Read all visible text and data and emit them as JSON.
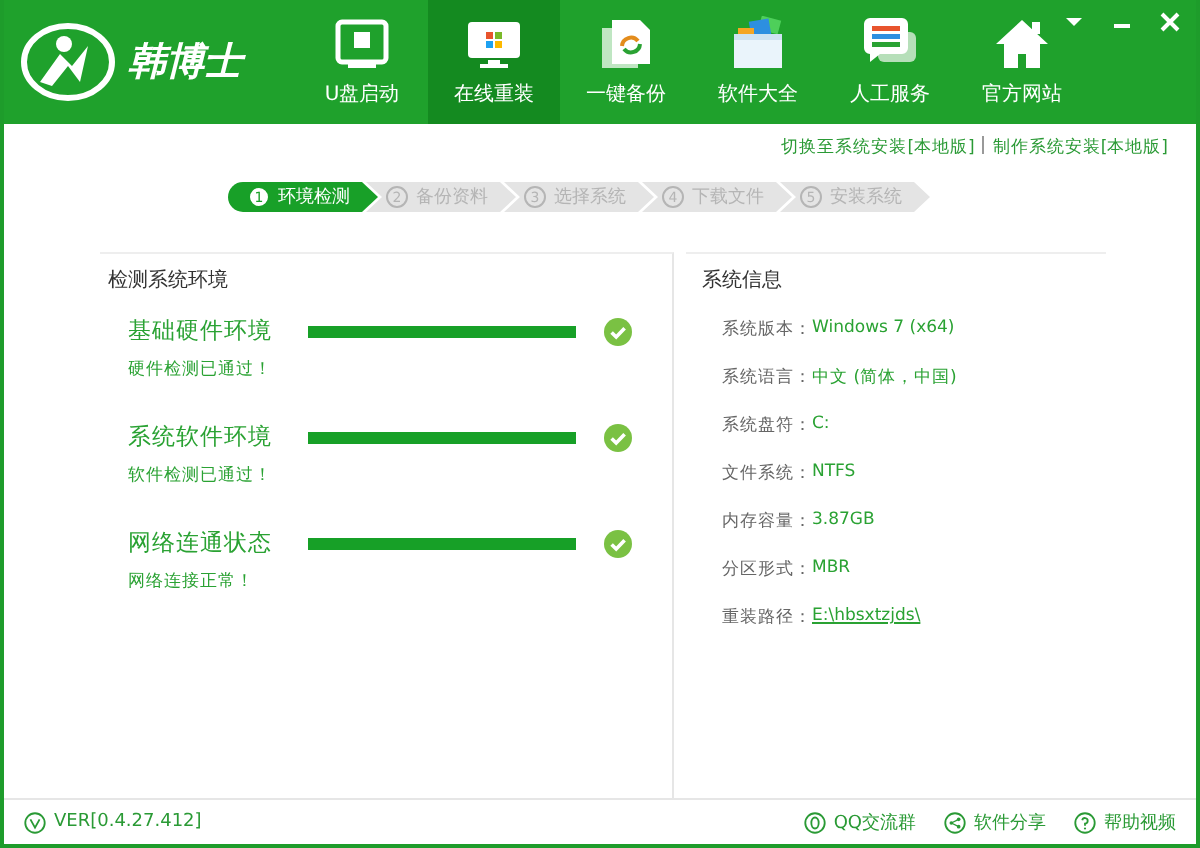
{
  "app": {
    "logo_text": "韩博士"
  },
  "nav": [
    {
      "label": "U盘启动",
      "selected": false
    },
    {
      "label": "在线重装",
      "selected": true
    },
    {
      "label": "一键备份",
      "selected": false
    },
    {
      "label": "软件大全",
      "selected": false
    },
    {
      "label": "人工服务",
      "selected": false
    },
    {
      "label": "官方网站",
      "selected": false
    }
  ],
  "top_links": [
    "切换至系统安装[本地版]",
    "制作系统安装[本地版]"
  ],
  "steps": [
    {
      "number": "1",
      "label": "环境检测",
      "selected": true
    },
    {
      "number": "2",
      "label": "备份资料",
      "selected": false
    },
    {
      "number": "3",
      "label": "选择系统",
      "selected": false
    },
    {
      "number": "4",
      "label": "下载文件",
      "selected": false
    },
    {
      "number": "5",
      "label": "安装系统",
      "selected": false
    }
  ],
  "check_panel": {
    "title": "检测系统环境",
    "items": [
      {
        "name": "基础硬件环境",
        "status": "硬件检测已通过！",
        "level": 1,
        "passed": true
      },
      {
        "name": "系统软件环境",
        "status": "软件检测已通过！",
        "level": 1,
        "passed": true
      },
      {
        "name": "网络连通状态",
        "status": "网络连接正常！",
        "level": 1,
        "passed": true
      }
    ]
  },
  "info_panel": {
    "title": "系统信息",
    "rows": [
      {
        "label": "系统版本：",
        "value": "Windows 7 (x64)",
        "kind": "text"
      },
      {
        "label": "系统语言：",
        "value": "中文 (简体，中国)",
        "kind": "text"
      },
      {
        "label": "系统盘符：",
        "value": "C:",
        "kind": "text"
      },
      {
        "label": "文件系统：",
        "value": "NTFS",
        "kind": "text"
      },
      {
        "label": "内存容量：",
        "value": "3.87GB",
        "kind": "text"
      },
      {
        "label": "分区形式：",
        "value": "MBR",
        "kind": "text"
      },
      {
        "label": "重装路径：",
        "value": "E:\\hbsxtzjds\\",
        "kind": "link"
      }
    ]
  },
  "footer": {
    "version": "VER[0.4.27.412]",
    "links": [
      "QQ交流群",
      "软件分享",
      "帮助视频"
    ]
  }
}
